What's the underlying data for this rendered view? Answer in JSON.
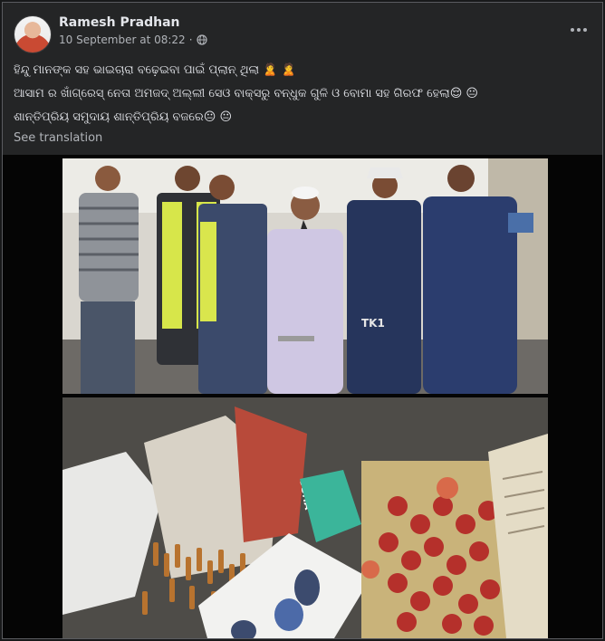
{
  "post": {
    "author": "Ramesh Pradhan",
    "timestamp": "10 September at 08:22",
    "separator": "·",
    "audience_icon": "globe-icon",
    "more_icon": "more-options-icon",
    "caption_lines": [
      "ହିନ୍ଦୁ ମାନଙ୍କ ସହ ଭାଇଚାରା ବଢ଼େଇବା ପାଇଁ ପ୍ଲାନ୍ ଥିଲା 🙎 🙎",
      "ଆସାମ ର ଖାଁଗ୍ରେସ୍ ନେତା ଅମଜଦ୍ ଅଲ୍ଲୀ ସେଓ ବାକ୍ସରୁ ବନ୍ଧୁକ ଗୁଳି ଓ ବୋମା ସହ ଗିରଫ ହେଲା😌 😐",
      "ଶାନ୍ତିପ୍ରିୟ ସମୁଦାୟ ଶାନ୍ତିପ୍ରିୟ ବଜରେ😐 😐"
    ],
    "see_translation": "See translation"
  },
  "photo_top": {
    "uniform_text": "TK1"
  },
  "photo_bottom": {
    "bag_text": "OSHA"
  },
  "colors": {
    "background": "#18191a",
    "card": "#242526",
    "text_primary": "#e4e6eb",
    "text_secondary": "#b0b3b8"
  }
}
